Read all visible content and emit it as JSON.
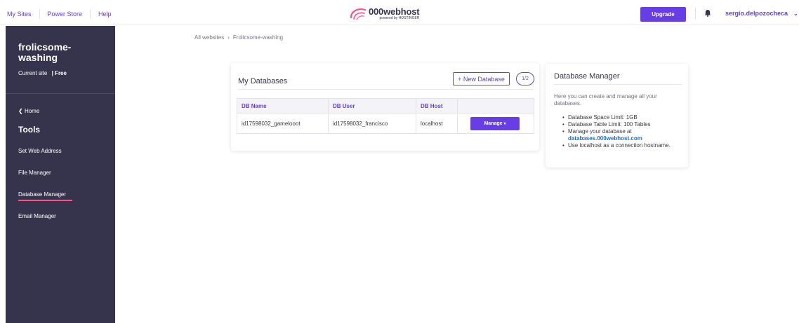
{
  "topbar": {
    "nav": [
      "My Sites",
      "Power Store",
      "Help"
    ],
    "logo_brand": "000webhost",
    "logo_powered": "powered by HOSTINGER",
    "upgrade_label": "Upgrade",
    "username": "sergio.delpozocheca",
    "icons": [
      "bell-icon",
      "chevron-down-icon"
    ]
  },
  "sidebar": {
    "site_name": "frolicsome-washing",
    "current_site_label": "Current site",
    "plan": "| Free",
    "home_label": "Home",
    "tools_heading": "Tools",
    "items": [
      "Set Web Address",
      "File Manager",
      "Database Manager",
      "Email Manager"
    ],
    "active_item": "Database Manager"
  },
  "breadcrumb": [
    "All websites",
    "Frolicsome-washing"
  ],
  "databases": {
    "title": "My Databases",
    "new_button": "+ New Database",
    "count": "1/2",
    "columns": [
      "DB Name",
      "DB User",
      "DB Host",
      ""
    ],
    "rows": [
      {
        "name": "id17598032_gamelooot",
        "user": "id17598032_francisco",
        "host": "localhost",
        "action": "Manage"
      }
    ]
  },
  "info": {
    "title": "Database Manager",
    "description": "Here you can create and manage all your databases.",
    "space_limit": "Database Space Limit: 1GB",
    "table_limit": "Database Table Limit: 100 Tables",
    "manage_text": "Manage your database at",
    "manage_link": "databases.000webhost.com",
    "localhost_tip": "Use localhost as a connection hostname."
  },
  "colors": {
    "accent": "#673de6",
    "sidebar_bg": "#36344d",
    "active_underline": "#fc5185",
    "link": "#1f6fbe",
    "logo_swirl": "#fc5185"
  }
}
